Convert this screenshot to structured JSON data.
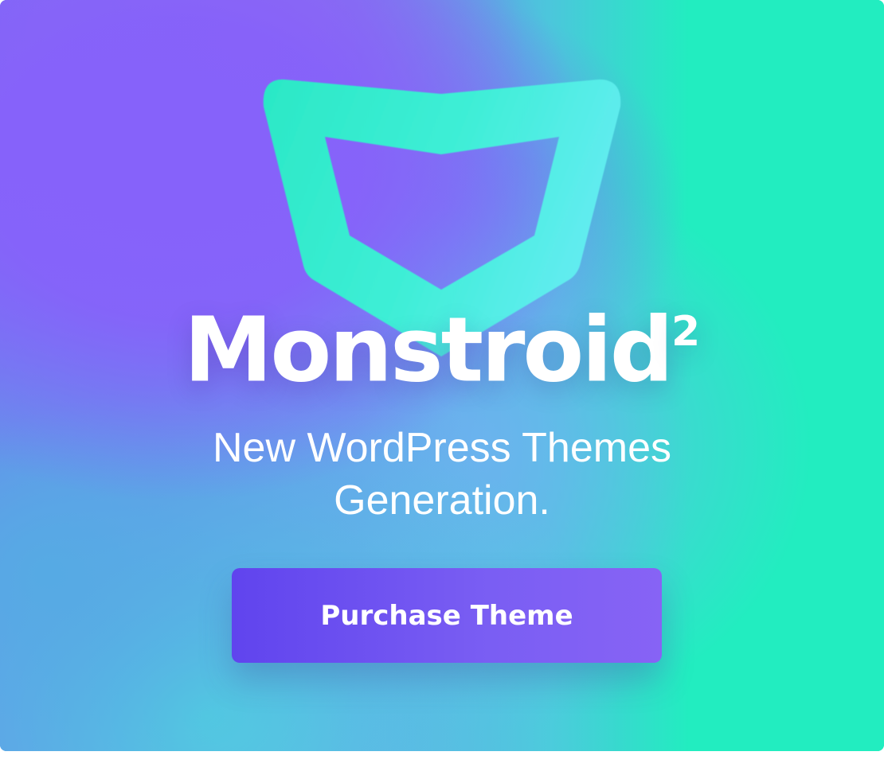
{
  "banner": {
    "title": "Monstroid",
    "title_superscript": "2",
    "subtitle_line1": "New WordPress Themes",
    "subtitle_line2": "Generation.",
    "cta_label": "Purchase Theme",
    "logo_icon": "shield-icon",
    "colors": {
      "purple": "#8662fa",
      "teal": "#22edc0",
      "button": "#6a4cf0",
      "logo": "#3ceed0"
    }
  }
}
